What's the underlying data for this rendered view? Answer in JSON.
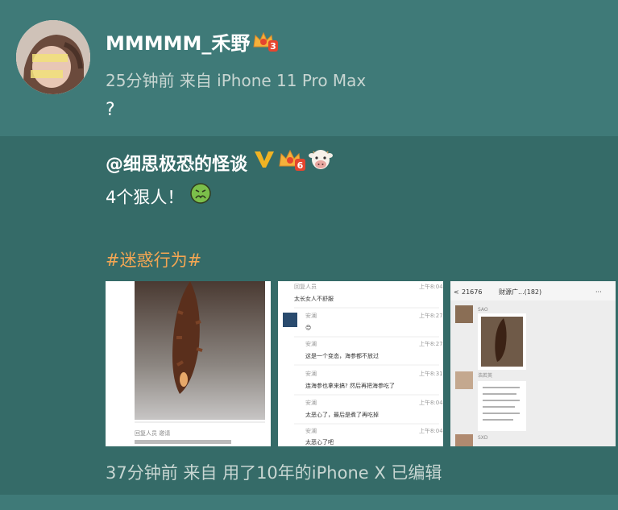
{
  "comment": {
    "username": "MMMMM_禾野",
    "time_source": "25分钟前 来自 iPhone 11 Pro Max",
    "text": "?",
    "badge_level": "3"
  },
  "repost": {
    "author": "@细思极恐的怪谈",
    "badge_level": "6",
    "text": "4个狠人！",
    "hashtag": "#迷惑行为#",
    "footer": "37分钟前 来自 用了10年的iPhone X   已编辑"
  },
  "images": [
    {
      "caption": "回复人员 邀请"
    },
    {
      "lines": [
        {
          "user": "回复人员",
          "text": "太长女人不舒服",
          "time": "上午8:04"
        },
        {
          "user": "安澜",
          "text": "😊",
          "time": "上午8:27"
        },
        {
          "user": "安澜",
          "text": "这是一个变态，海参都不放过",
          "time": "上午8:27"
        },
        {
          "user": "安澜",
          "text": "连海参也拿来搞? 然后再把海参吃了",
          "time": "上午8:31"
        },
        {
          "user": "安澜",
          "text": "太恶心了，最后是煮了再吃掉",
          "time": "上午8:04"
        },
        {
          "user": "安澜",
          "text": "太恶心了吧",
          "time": "上午8:04"
        }
      ]
    },
    {
      "back": "21676",
      "group": "财源广...(182)",
      "names": [
        "SAO",
        "浩若英",
        "SXD"
      ]
    }
  ],
  "colors": {
    "background": "#3f7a78",
    "repost_bg": "#356b68",
    "hashtag": "#f3a653",
    "meta": "#c8d6d2"
  }
}
